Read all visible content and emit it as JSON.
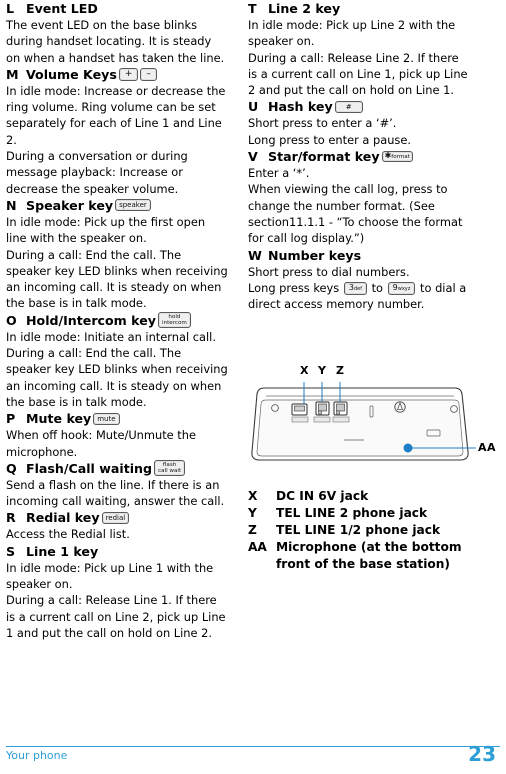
{
  "footer": {
    "section": "Your phone",
    "page": "23",
    "accent": "#2d9fd6"
  },
  "left_column": [
    {
      "type": "header",
      "letter": "L",
      "label": "Event LED"
    },
    {
      "type": "para",
      "text": "The event LED on the base blinks during handset locating. It is steady on when a handset has taken the line."
    },
    {
      "type": "header",
      "letter": "M",
      "label": "Volume Keys",
      "keys": [
        "+",
        "–"
      ]
    },
    {
      "type": "para",
      "text": "In idle mode: Increase or decrease the ring volume. Ring volume can be set separately for each of Line 1 and Line 2."
    },
    {
      "type": "para",
      "text": "During a conversation or during message playback: Increase or decrease the speaker volume."
    },
    {
      "type": "header",
      "letter": "N",
      "label": "Speaker key",
      "key": "speaker"
    },
    {
      "type": "para",
      "text": "In idle mode: Pick up the first open line with the speaker on."
    },
    {
      "type": "para",
      "text": "During a call: End the call. The speaker key LED blinks when receiving an incoming call. It is steady on when the base is in talk mode."
    },
    {
      "type": "header",
      "letter": "O",
      "label": "Hold/Intercom key",
      "key": "hold intercom"
    },
    {
      "type": "para",
      "text": "In idle mode: Initiate an internal call."
    },
    {
      "type": "para",
      "text": "During a call: End the call. The speaker key LED blinks when receiving an incoming call. It is steady on when the base is in talk mode."
    },
    {
      "type": "header",
      "letter": "P",
      "label": "Mute key",
      "key": "mute"
    },
    {
      "type": "para",
      "text": "When off hook: Mute/Unmute the microphone."
    },
    {
      "type": "header",
      "letter": "Q",
      "label": "Flash/Call waiting",
      "key": "flash call wait"
    },
    {
      "type": "para",
      "text": "Send a flash on the line. If there is an incoming call waiting, answer the call."
    },
    {
      "type": "header",
      "letter": "R",
      "label": "Redial key",
      "key": "redial"
    },
    {
      "type": "para",
      "text": "Access the Redial list."
    },
    {
      "type": "header",
      "letter": "S",
      "label": "Line 1 key"
    },
    {
      "type": "para",
      "text": "In idle mode: Pick up Line 1 with the speaker on."
    },
    {
      "type": "para",
      "text": "During a call: Release Line 1. If there is a current call on Line 2, pick up Line 1 and put the call on hold on Line 2."
    }
  ],
  "right_column": [
    {
      "type": "header",
      "letter": "T",
      "label": "Line 2 key"
    },
    {
      "type": "para",
      "text": "In idle mode: Pick up Line 2 with the speaker on."
    },
    {
      "type": "para",
      "text": "During a call: Release Line 2. If there is a current call on Line 1, pick up Line 2 and put the call on hold on Line 1."
    },
    {
      "type": "header",
      "letter": "U",
      "label": "Hash key",
      "key": "#"
    },
    {
      "type": "para",
      "text": "Short press to enter a ‘#’."
    },
    {
      "type": "para",
      "text": "Long press to enter a pause."
    },
    {
      "type": "header",
      "letter": "V",
      "label": "Star/format key",
      "key": "*format"
    },
    {
      "type": "para",
      "text": "Enter a ‘*’."
    },
    {
      "type": "para",
      "text": "When viewing the call log, press to change the number format. (See section11.1.1 - “To choose the format for call log display.”)"
    },
    {
      "type": "header",
      "letter": "W",
      "label": "Number keys"
    },
    {
      "type": "para",
      "text": "Short press to dial numbers."
    },
    {
      "type": "para_keys",
      "before": "Long press keys",
      "key1": "3def",
      "mid": "to",
      "key2": "9wxyz",
      "after": "to dial a direct access memory number."
    }
  ],
  "figure": {
    "callouts": [
      "X",
      "Y",
      "Z",
      "AA"
    ],
    "legend": [
      {
        "key": "X",
        "text": "DC IN 6V jack"
      },
      {
        "key": "Y",
        "text": "TEL LINE 2 phone jack"
      },
      {
        "key": "Z",
        "text": "TEL LINE 1/2 phone jack"
      },
      {
        "key": "AA",
        "text": "Microphone (at the bottom",
        "text2": "front of the base station)"
      }
    ]
  }
}
